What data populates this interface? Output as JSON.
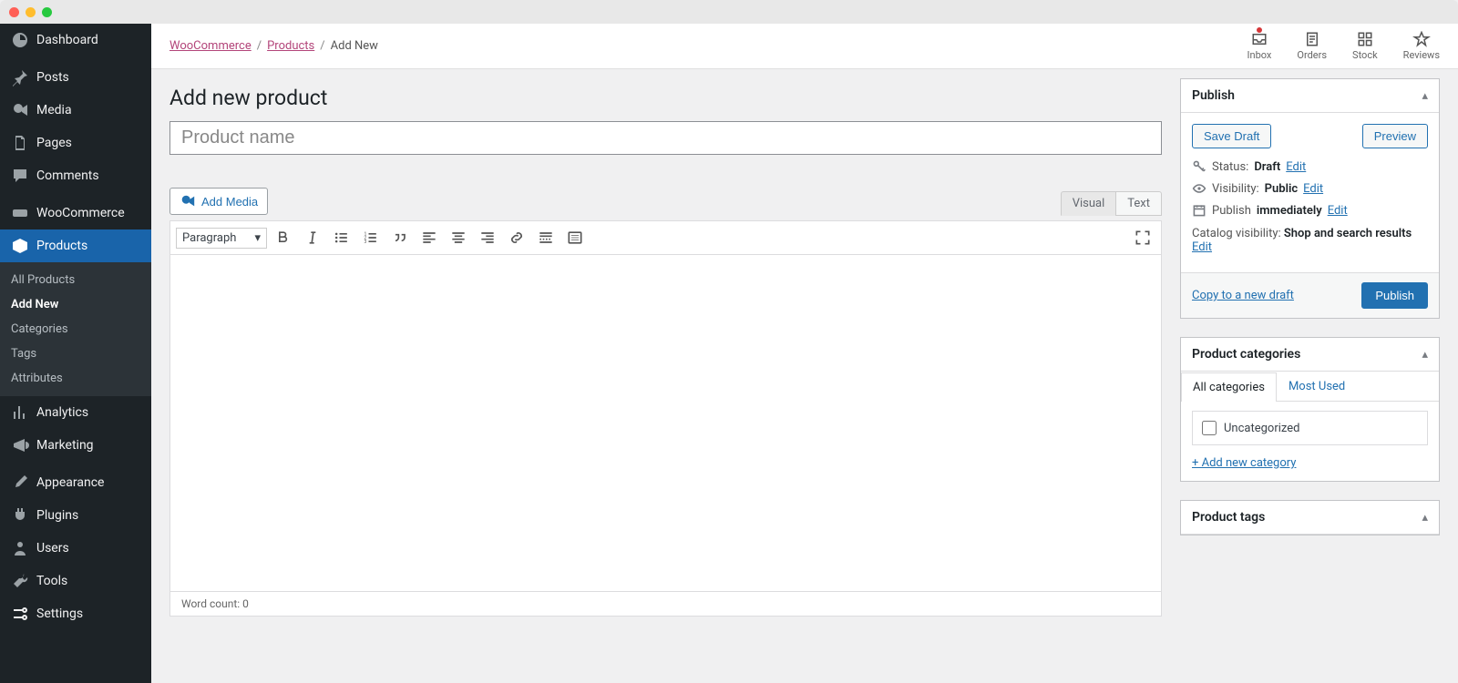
{
  "sidebar": {
    "items": [
      {
        "label": "Dashboard",
        "icon": "dashboard"
      },
      {
        "label": "Posts",
        "icon": "pin"
      },
      {
        "label": "Media",
        "icon": "media"
      },
      {
        "label": "Pages",
        "icon": "pages"
      },
      {
        "label": "Comments",
        "icon": "comments"
      },
      {
        "label": "WooCommerce",
        "icon": "woo"
      },
      {
        "label": "Products",
        "icon": "products",
        "current": true
      },
      {
        "label": "Analytics",
        "icon": "analytics"
      },
      {
        "label": "Marketing",
        "icon": "marketing"
      },
      {
        "label": "Appearance",
        "icon": "appearance"
      },
      {
        "label": "Plugins",
        "icon": "plugins"
      },
      {
        "label": "Users",
        "icon": "users"
      },
      {
        "label": "Tools",
        "icon": "tools"
      },
      {
        "label": "Settings",
        "icon": "settings"
      }
    ],
    "submenu": [
      {
        "label": "All Products"
      },
      {
        "label": "Add New",
        "current": true
      },
      {
        "label": "Categories"
      },
      {
        "label": "Tags"
      },
      {
        "label": "Attributes"
      }
    ]
  },
  "breadcrumb": {
    "items": [
      "WooCommerce",
      "Products"
    ],
    "current": "Add New"
  },
  "topbar": {
    "actions": [
      {
        "label": "Inbox",
        "icon": "inbox",
        "notif": true
      },
      {
        "label": "Orders",
        "icon": "orders"
      },
      {
        "label": "Stock",
        "icon": "stock"
      },
      {
        "label": "Reviews",
        "icon": "reviews"
      }
    ]
  },
  "page": {
    "title": "Add new product",
    "title_placeholder": "Product name"
  },
  "editor": {
    "add_media": "Add Media",
    "tabs": {
      "visual": "Visual",
      "text": "Text"
    },
    "paragraph": "Paragraph",
    "word_count": "Word count: 0"
  },
  "publish": {
    "title": "Publish",
    "save_draft": "Save Draft",
    "preview": "Preview",
    "status_label": "Status:",
    "status_value": "Draft",
    "visibility_label": "Visibility:",
    "visibility_value": "Public",
    "publish_label": "Publish",
    "publish_value": "immediately",
    "catalog_label": "Catalog visibility:",
    "catalog_value": "Shop and search results",
    "edit": "Edit",
    "copy": "Copy to a new draft",
    "publish_btn": "Publish"
  },
  "categories": {
    "title": "Product categories",
    "tab_all": "All categories",
    "tab_most": "Most Used",
    "uncategorized": "Uncategorized",
    "add_new": "+ Add new category"
  },
  "tags": {
    "title": "Product tags"
  }
}
